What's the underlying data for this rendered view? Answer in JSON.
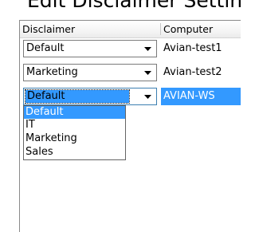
{
  "dialog": {
    "title": "Edit Disclaimer Settings"
  },
  "grid": {
    "columns": [
      "Disclaimer",
      "Computer"
    ],
    "rows": [
      {
        "disclaimer": "Default",
        "computer": "Avian-test1"
      },
      {
        "disclaimer": "Marketing",
        "computer": "Avian-test2"
      },
      {
        "disclaimer": "Default",
        "computer": "AVIAN-WS"
      }
    ]
  },
  "dropdown": {
    "options": [
      "Default",
      "IT",
      "Marketing",
      "Sales"
    ],
    "selected": "Default"
  },
  "colors": {
    "selection": "#3399ff",
    "border": "#7a7a7a",
    "focus_border": "#3c7fb1"
  },
  "icons": {
    "combo_arrow": "chevron-down-icon"
  }
}
